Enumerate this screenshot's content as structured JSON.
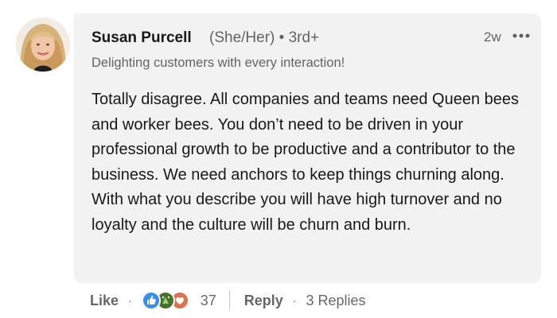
{
  "comment": {
    "author_name": "Susan Purcell",
    "pronoun_degree": "(She/Her) • 3rd+",
    "headline": "Delighting customers with every interaction!",
    "timestamp": "2w",
    "body": "Totally disagree. All companies and teams need Queen bees and worker bees. You don’t need to be driven in your professional growth to be productive and a contributor to the business. We need anchors to keep things churning along. With what you describe you will have high turnover and no loyalty and the culture will be churn and burn."
  },
  "actions": {
    "like_label": "Like",
    "separator": "·",
    "reaction_count": "37",
    "reactions": [
      "like-icon",
      "celebrate-icon",
      "love-icon"
    ],
    "reply_label": "Reply",
    "replies_label": "3 Replies"
  },
  "colors": {
    "bubble_bg": "#f2f2f2",
    "like_blue": "#378fe9",
    "celebrate_green": "#44712e",
    "love_red": "#df704d"
  }
}
